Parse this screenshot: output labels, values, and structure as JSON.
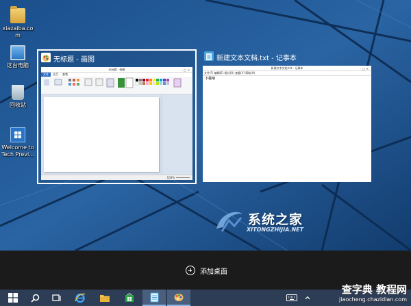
{
  "desktop": {
    "icons": [
      {
        "label": "xiazaiba.co\nm"
      },
      {
        "label": "这台电脑"
      },
      {
        "label": "回收站"
      },
      {
        "label": "Welcome to\nTech Previ..."
      }
    ]
  },
  "task_view": {
    "windows": [
      {
        "title": "无标题 - 画图",
        "inner_title": "无标题 - 画图",
        "ribbon_tabs": [
          "文件",
          "主页",
          "查看"
        ],
        "status": "100%"
      },
      {
        "title": "新建文本文档.txt - 记事本",
        "inner_title": "新建文本文档.txt - 记事本",
        "menu": "文件(F) 编辑(E) 格式(O) 查看(V) 帮助(H)",
        "content": "下载吧"
      }
    ],
    "add_desktop_label": "添加桌面"
  },
  "watermark": {
    "brand_cn": "系统之家",
    "brand_en": "XITONGZHIJIA.NET",
    "corner_cn": "查字典 教程网",
    "corner_url": "jiaocheng.chazidian.com"
  },
  "colors": {
    "wallpaper": "#1d4f86",
    "taskbar": "#2d3d55",
    "task_view_band": "#1b1b1b",
    "selection_border": "#ffffff"
  },
  "icons": {
    "start": "windows-logo-icon",
    "search": "search-icon",
    "task_view": "task-view-icon",
    "ie": "internet-explorer-icon",
    "explorer": "file-explorer-icon",
    "store": "store-icon",
    "notepad": "notepad-icon",
    "paint": "paint-icon",
    "keyboard": "keyboard-icon"
  }
}
